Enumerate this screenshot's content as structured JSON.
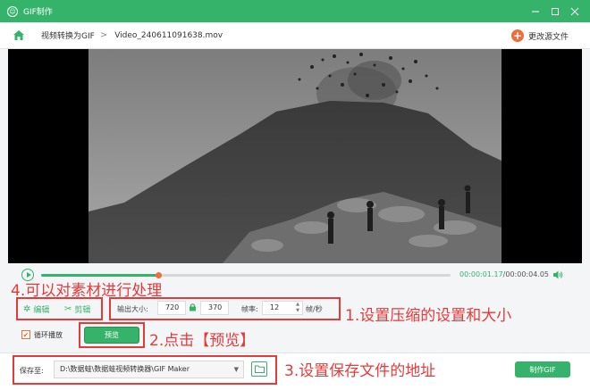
{
  "window": {
    "title": "GIF制作",
    "controls": [
      "minimize-icon",
      "maximize-icon",
      "close-icon"
    ]
  },
  "toolbar": {
    "breadcrumb_root": "视频转换为GIF",
    "breadcrumb_separator": ">",
    "file_name": "Video_240611091638.mov",
    "change_source_label": "更改源文件"
  },
  "player": {
    "current_time": "00:00:01.17",
    "total_time": "/00:00:04.05",
    "progress": 0.286
  },
  "edit": {
    "edit_label": "编辑",
    "cut_label": "剪辑"
  },
  "settings": {
    "output_size_label": "输出大小:",
    "width": "720",
    "height": "370",
    "fps_label": "帧率:",
    "fps": "12",
    "fps_unit": "帧/秒"
  },
  "options": {
    "loop_label": "循环播放",
    "loop_checked": true,
    "preview_label": "预览"
  },
  "output": {
    "save_to_label": "保存至:",
    "path": "D:\\数据蛙\\数据蛙视频转换器\\GIF Maker",
    "make_gif_label": "制作GIF"
  },
  "annotations": {
    "a1": "1.设置压缩的设置和大小",
    "a2": "2.点击【预览】",
    "a3": "3.设置保存文件的地址",
    "a4": "4.可以对素材进行处理"
  },
  "colors": {
    "accent": "#35b36b",
    "orange": "#f26b3a",
    "annotation": "#e63a3a"
  }
}
